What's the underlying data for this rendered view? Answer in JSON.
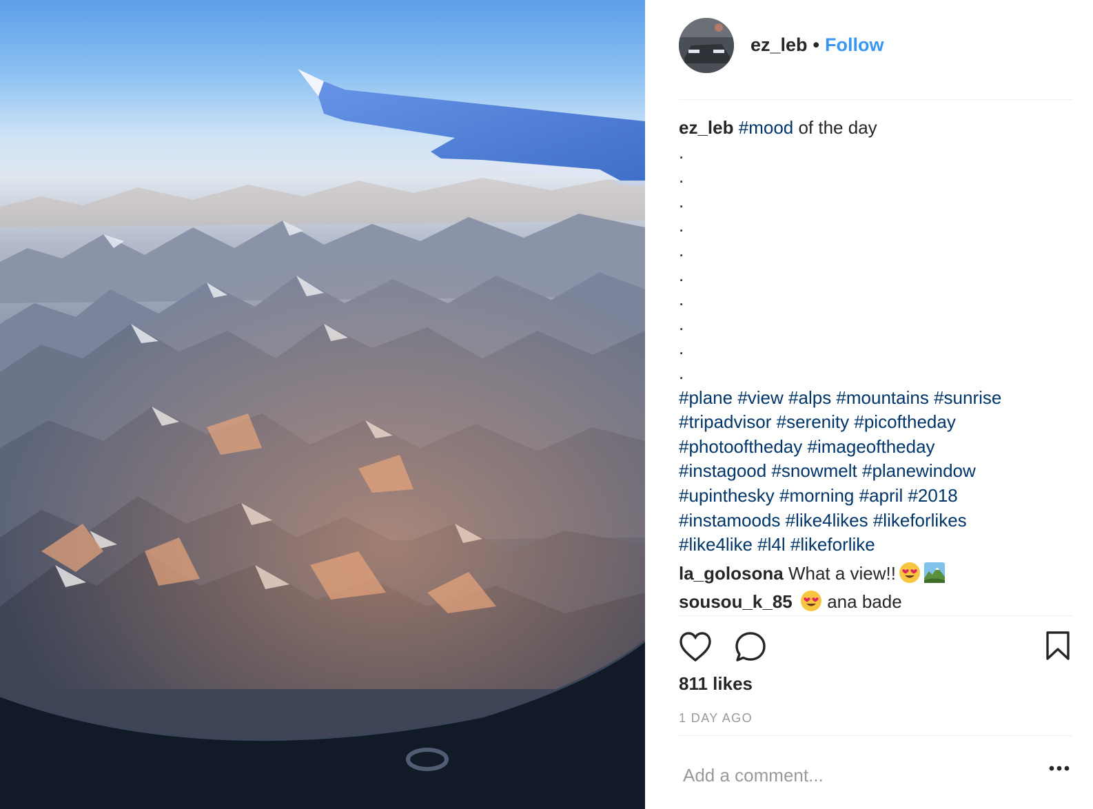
{
  "post": {
    "username": "ez_leb",
    "separator": "•",
    "follow_label": "Follow",
    "caption": {
      "user": "ez_leb",
      "tag": "#mood",
      "text": " of the day",
      "dots": [
        ".",
        ".",
        ".",
        ".",
        ".",
        ".",
        ".",
        ".",
        ".",
        "."
      ],
      "hashtag_lines": [
        [
          "#plane",
          "#view",
          "#alps",
          "#mountains",
          "#sunrise"
        ],
        [
          "#tripadvisor",
          "#serenity",
          "#picoftheday"
        ],
        [
          "#photooftheday",
          "#imageoftheday"
        ],
        [
          "#instagood",
          "#snowmelt",
          "#planewindow"
        ],
        [
          "#upinthesky",
          "#morning",
          "#april",
          "#2018"
        ],
        [
          "#instamoods",
          "#like4likes",
          "#likeforlikes"
        ],
        [
          "#like4like",
          "#l4l",
          "#likeforlike"
        ]
      ]
    },
    "comments": [
      {
        "user": "la_golosona",
        "text": "What a view!!",
        "emojis": [
          "heart-eyes-emoji",
          "national-park-emoji"
        ]
      },
      {
        "user": "sousou_k_85",
        "text": "ana bade",
        "emojis": [
          "heart-eyes-emoji"
        ]
      }
    ],
    "likes": "811 likes",
    "time_ago": "1 DAY AGO",
    "add_comment_placeholder": "Add a comment...",
    "icons": [
      "heart-icon",
      "comment-icon",
      "bookmark-icon",
      "more-options-icon"
    ],
    "colors": {
      "link": "#3897f0",
      "hashtag": "#003569",
      "text": "#262626",
      "muted": "#999999",
      "divider": "#efefef"
    }
  }
}
